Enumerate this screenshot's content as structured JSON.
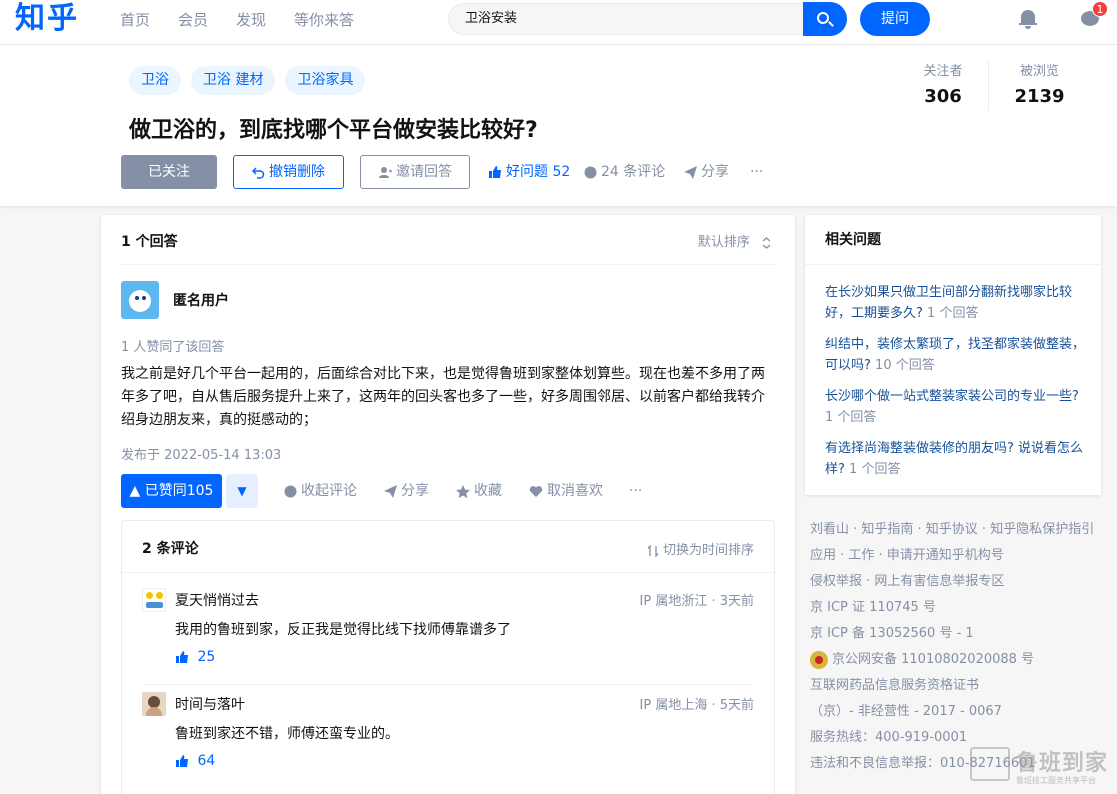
{
  "header": {
    "logo": "知乎",
    "nav": [
      "首页",
      "会员",
      "发现",
      "等你来答"
    ],
    "search_value": "卫浴安装",
    "ask_label": "提问",
    "msg_badge": "1"
  },
  "question": {
    "topics": [
      "卫浴",
      "卫浴 建材",
      "卫浴家具"
    ],
    "title": "做卫浴的，到底找哪个平台做安装比较好?",
    "followers_label": "关注者",
    "followers": "306",
    "views_label": "被浏览",
    "views": "2139",
    "followed_label": "已关注",
    "undo_delete_label": "撤销删除",
    "invite_label": "邀请回答",
    "good_label": "好问题",
    "good_count": "52",
    "comments_label": "24 条评论",
    "share_label": "分享",
    "more": "···"
  },
  "answers": {
    "count_label": "1 个回答",
    "sort_label": "默认排序",
    "author": "匿名用户",
    "agree_note": "1 人赞同了该回答",
    "body": "我之前是好几个平台一起用的，后面综合对比下来，也是觉得鲁班到家整体划算些。现在也差不多用了两年多了吧，自从售后服务提升上来了，这两年的回头客也多了一些，好多周围邻居、以前客户都给我转介绍身边朋友来，真的挺感动的；",
    "published": "发布于 2022-05-14 13:03",
    "vote_label": "▲ 已赞同105",
    "vote_down": "▼",
    "collapse_comments": "收起评论",
    "share": "分享",
    "collect": "收藏",
    "unlike": "取消喜欢",
    "more": "···"
  },
  "comments": {
    "count_label": "2 条评论",
    "sort_label": "切换为时间排序",
    "items": [
      {
        "name": "夏天悄悄过去",
        "ip": "IP 属地浙江 · 3天前",
        "text": "我用的鲁班到家，反正我是觉得比线下找师傅靠谱多了",
        "likes": "25"
      },
      {
        "name": "时间与落叶",
        "ip": "IP 属地上海 · 5天前",
        "text": "鲁班到家还不错，师傅还蛮专业的。",
        "likes": "64"
      }
    ]
  },
  "sidebar": {
    "title": "相关问题",
    "related": [
      {
        "q": "在长沙如果只做卫生间部分翻新找哪家比较好，工期要多久?",
        "n": "1 个回答"
      },
      {
        "q": "纠结中，装修太繁琐了，找圣都家装做整装，可以吗?",
        "n": "10 个回答"
      },
      {
        "q": "长沙哪个做一站式整装家装公司的专业一些?",
        "n": "1 个回答"
      },
      {
        "q": "有选择尚海整装做装修的朋友吗? 说说看怎么样?",
        "n": "1 个回答"
      }
    ],
    "footer": [
      "刘看山 · 知乎指南 · 知乎协议 · 知乎隐私保护指引",
      "应用 · 工作 · 申请开通知乎机构号",
      "侵权举报 · 网上有害信息举报专区",
      "京 ICP 证 110745 号",
      "京 ICP 备 13052560 号 - 1",
      "京公网安备 11010802020088 号",
      "互联网药品信息服务资格证书",
      "（京）- 非经营性 - 2017 - 0067",
      "服务热线：400-919-0001",
      "违法和不良信息举报：010-82716601"
    ]
  },
  "watermark": {
    "brand": "鲁班到家",
    "sub": "鲁班技工服务共享平台"
  }
}
